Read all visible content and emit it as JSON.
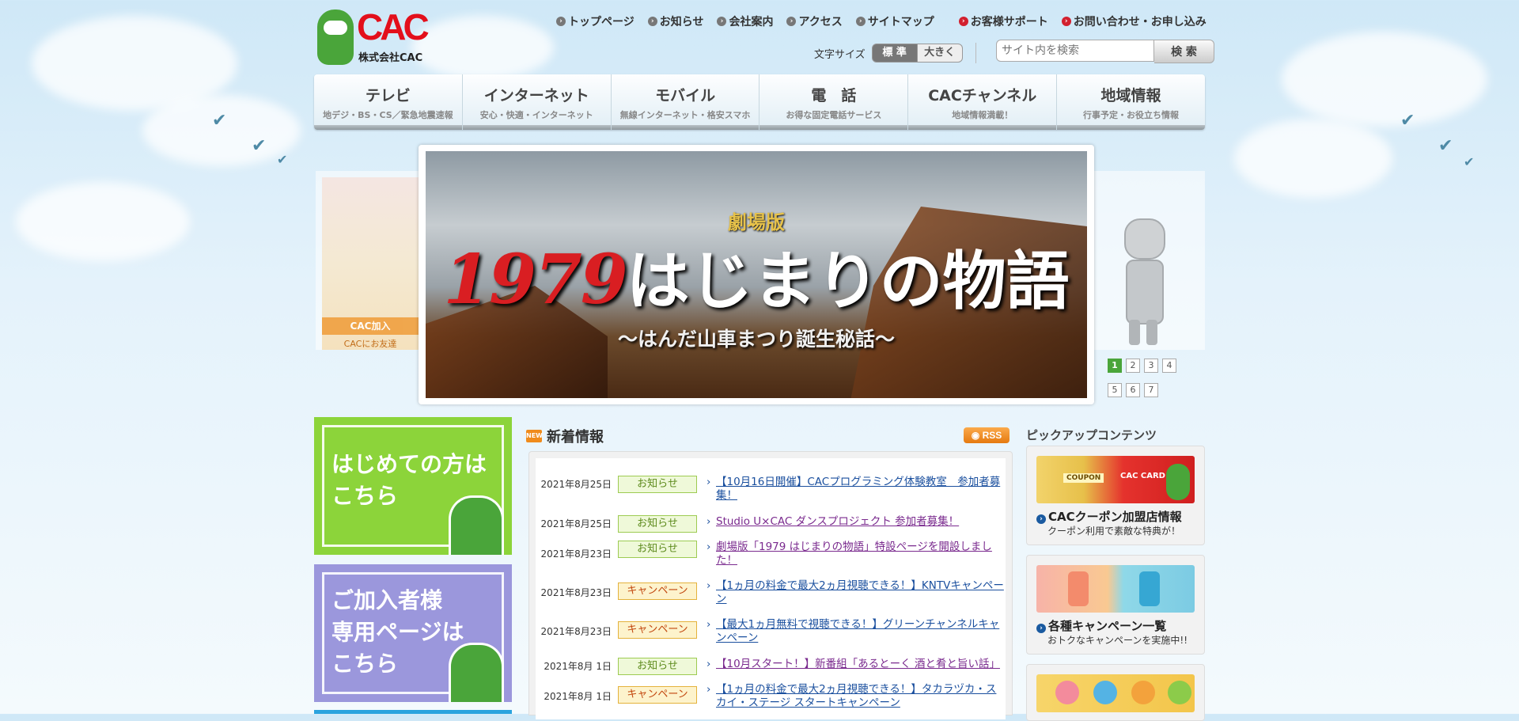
{
  "header": {
    "logo_text": "CAC",
    "company": "株式会社CAC",
    "top_links": [
      "トップページ",
      "お知らせ",
      "会社案内",
      "アクセス",
      "サイトマップ"
    ],
    "support_links": [
      "お客様サポート",
      "お問い合わせ・お申し込み"
    ],
    "font_size_label": "文字サイズ",
    "font_standard": "標 準",
    "font_large": "大きく",
    "search_placeholder": "サイト内を検索",
    "search_button": "検 索"
  },
  "global_nav": [
    {
      "title": "テレビ",
      "sub": "地デジ・BS・CS／緊急地震速報"
    },
    {
      "title": "インターネット",
      "sub": "安心・快適・インターネット"
    },
    {
      "title": "モバイル",
      "sub": "無線インターネット・格安スマホ"
    },
    {
      "title": "電　話",
      "sub": "お得な固定電話サービス"
    },
    {
      "title": "CACチャンネル",
      "sub": "地域情報満載！"
    },
    {
      "title": "地域情報",
      "sub": "行事予定・お役立ち情報"
    }
  ],
  "carousel": {
    "left_thumb_caption": "CAC加入",
    "left_thumb_sub": "CACにお友達",
    "hero_sub": "劇場版",
    "hero_year": "1979",
    "hero_title": "はじまりの物語",
    "hero_tagline": "〜はんだ山車まつり誕生秘話〜",
    "pages": [
      "1",
      "2",
      "3",
      "4",
      "5",
      "6",
      "7"
    ],
    "active_page": "1"
  },
  "banners": {
    "first_time": "はじめての方は\nこちら",
    "members": "ご加入者様\n専用ページは\nこちら"
  },
  "news": {
    "title": "新着情報",
    "rss": "RSS",
    "items": [
      {
        "date": "2021年8月25日",
        "tag": "お知らせ",
        "type": "info",
        "text": "【10月16日開催】CACプログラミング体験教室　参加者募集！"
      },
      {
        "date": "2021年8月25日",
        "tag": "お知らせ",
        "type": "info",
        "text": "Studio U×CAC ダンスプロジェクト 参加者募集！"
      },
      {
        "date": "2021年8月23日",
        "tag": "お知らせ",
        "type": "info",
        "text": "劇場版「1979 はじまりの物語」特設ページを開設しました！"
      },
      {
        "date": "2021年8月23日",
        "tag": "キャンペーン",
        "type": "camp",
        "text": "【1ヵ月の料金で最大2ヵ月視聴できる！】KNTVキャンペーン"
      },
      {
        "date": "2021年8月23日",
        "tag": "キャンペーン",
        "type": "camp",
        "text": "【最大1ヵ月無料で視聴できる！】グリーンチャンネルキャンペーン"
      },
      {
        "date": "2021年8月 1日",
        "tag": "お知らせ",
        "type": "info",
        "text": "【10月スタート！】新番組「あるとーく 酒と肴と旨い話」"
      },
      {
        "date": "2021年8月 1日",
        "tag": "キャンペーン",
        "type": "camp",
        "text": "【1ヵ月の料金で最大2ヵ月視聴できる！】タカラヅカ・スカイ・ステージ スタートキャンペーン"
      }
    ]
  },
  "pickup": {
    "title": "ピックアップコンテンツ",
    "cards": [
      {
        "title": "CACクーポン加盟店情報",
        "sub": "クーポン利用で素敵な特典が！",
        "img_labels": [
          "COUPON",
          "CAC CARD"
        ]
      },
      {
        "title": "各種キャンペーン一覧",
        "sub": "おトクなキャンペーンを実施中!!"
      }
    ]
  },
  "colors": {
    "brand_red": "#e30f1b",
    "brand_green": "#4aa53a",
    "info_tag": "#9dcb52",
    "camp_tag": "#e4b23c",
    "link": "#1a4f9e"
  }
}
